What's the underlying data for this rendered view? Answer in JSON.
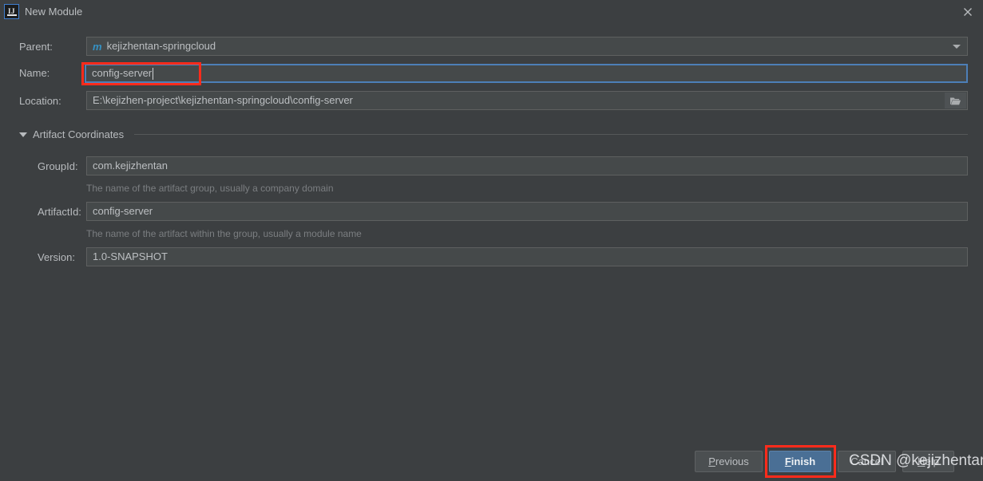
{
  "window": {
    "title": "New Module",
    "app_icon": "intellij-idea-icon",
    "close_icon": "close-icon",
    "background_color": "#3c3f41"
  },
  "form": {
    "parent": {
      "label": "Parent:",
      "value": "kejizhentan-springcloud",
      "icon": "maven-module-icon",
      "icon_glyph": "m",
      "dropdown_icon": "chevron-down-icon"
    },
    "name": {
      "label": "Name:",
      "value": "config-server",
      "focused": true,
      "highlight_color": "#ff2b1b"
    },
    "location": {
      "label": "Location:",
      "value": "E:\\kejizhen-project\\kejizhentan-springcloud\\config-server",
      "browse_icon": "folder-icon"
    }
  },
  "artifact_section": {
    "title": "Artifact Coordinates",
    "expanded": true,
    "toggle_icon": "triangle-down-icon",
    "fields": [
      {
        "label": "GroupId:",
        "value": "com.kejizhentan",
        "hint": "The name of the artifact group, usually a company domain"
      },
      {
        "label": "ArtifactId:",
        "value": "config-server",
        "hint": "The name of the artifact within the group, usually a module name"
      },
      {
        "label": "Version:",
        "value": "1.0-SNAPSHOT",
        "hint": ""
      }
    ]
  },
  "buttons": {
    "previous": {
      "label": "Previous",
      "mnemonic": "P",
      "rest": "revious"
    },
    "finish": {
      "label": "Finish",
      "mnemonic": "F",
      "rest": "inish",
      "default": true,
      "highlight_color": "#ff2b1b"
    },
    "cancel": {
      "label": "Cancel"
    },
    "help": {
      "label": "Help",
      "mnemonic": "H",
      "rest": "elp"
    }
  },
  "watermark": {
    "text": "CSDN @kejizhentan"
  }
}
